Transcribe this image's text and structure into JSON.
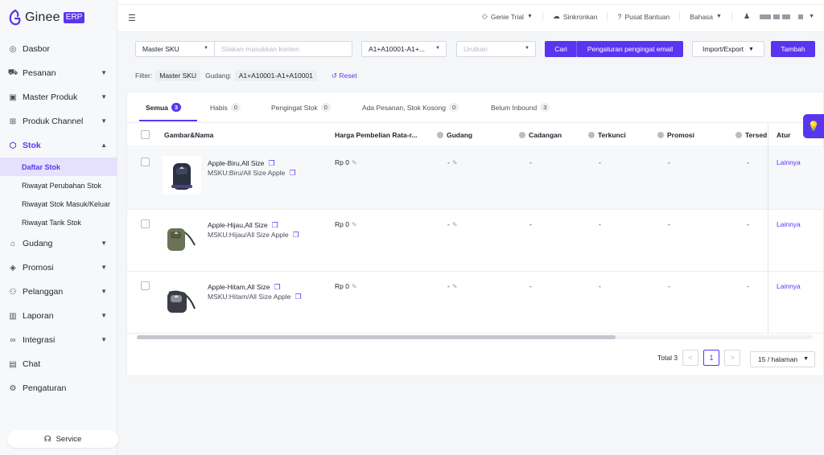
{
  "brand": {
    "name": "Ginee",
    "badge": "ERP"
  },
  "topbar": {
    "genie": "Genie Trial",
    "sync": "Sinkronkan",
    "help": "Pusat Bantuan",
    "language": "Bahasa"
  },
  "sidebar": {
    "items": [
      {
        "label": "Dasbor",
        "icon": "dashboard-icon"
      },
      {
        "label": "Pesanan",
        "icon": "cart-icon"
      },
      {
        "label": "Master Produk",
        "icon": "bag-icon"
      },
      {
        "label": "Produk Channel",
        "icon": "channel-icon"
      },
      {
        "label": "Stok",
        "icon": "box-icon"
      },
      {
        "label": "Gudang",
        "icon": "warehouse-icon"
      },
      {
        "label": "Promosi",
        "icon": "tag-icon"
      },
      {
        "label": "Pelanggan",
        "icon": "users-icon"
      },
      {
        "label": "Laporan",
        "icon": "chart-icon"
      },
      {
        "label": "Integrasi",
        "icon": "link-icon"
      },
      {
        "label": "Chat",
        "icon": "chat-icon"
      },
      {
        "label": "Pengaturan",
        "icon": "gear-icon"
      }
    ],
    "stok_sub": [
      "Daftar Stok",
      "Riwayat Perubahan Stok",
      "Riwayat Stok Masuk/Keluar",
      "Riwayat Tarik Stok"
    ],
    "service": "Service"
  },
  "filters": {
    "type_select": "Master SKU",
    "search_placeholder": "Silakan masukkan konten",
    "warehouse_select": "A1+A10001-A1+...",
    "sort_placeholder": "Urutkan",
    "search_btn": "Cari",
    "email_btn": "Pengaturan pengingat email",
    "import_export": "Import/Export",
    "add_btn": "Tambah",
    "filter_label": "Filter:",
    "chip1": "Master SKU",
    "gudang_label": "Gudang:",
    "chip2": "A1+A10001-A1+A10001",
    "reset": "Reset"
  },
  "tabs": [
    {
      "label": "Semua",
      "count": "3"
    },
    {
      "label": "Habis",
      "count": "0"
    },
    {
      "label": "Pengingat Stok",
      "count": "0"
    },
    {
      "label": "Ada Pesanan, Stok Kosong",
      "count": "0"
    },
    {
      "label": "Belum Inbound",
      "count": "3"
    }
  ],
  "columns": {
    "image_name": "Gambar&Nama",
    "avg_price": "Harga Pembelian Rata-r...",
    "warehouse": "Gudang",
    "reserved": "Cadangan",
    "locked": "Terkunci",
    "promo": "Promosi",
    "available": "Tersed",
    "action": "Atur"
  },
  "rows": [
    {
      "name": "Apple-Biru,All Size",
      "msku": "MSKU:Biru/All Size Apple",
      "price": "Rp 0",
      "warehouse": "-",
      "reserved": "-",
      "locked": "-",
      "promo": "-",
      "available": "-",
      "action": "Lainnya",
      "color": "#2b3042"
    },
    {
      "name": "Apple-Hijau,All Size",
      "msku": "MSKU:Hijau/All Size Apple",
      "price": "Rp 0",
      "warehouse": "-",
      "reserved": "-",
      "locked": "-",
      "promo": "-",
      "available": "-",
      "action": "Lainnya",
      "color": "#6b7356"
    },
    {
      "name": "Apple-Hitam,All Size",
      "msku": "MSKU:Hitam/All Size Apple",
      "price": "Rp 0",
      "warehouse": "-",
      "reserved": "-",
      "locked": "-",
      "promo": "-",
      "available": "-",
      "action": "Lainnya",
      "color": "#3a3d44"
    }
  ],
  "pagination": {
    "total": "Total 3",
    "prev": "<",
    "current": "1",
    "next": ">",
    "page_size": "15 / halaman"
  },
  "colors": {
    "accent": "#5a35f0"
  }
}
